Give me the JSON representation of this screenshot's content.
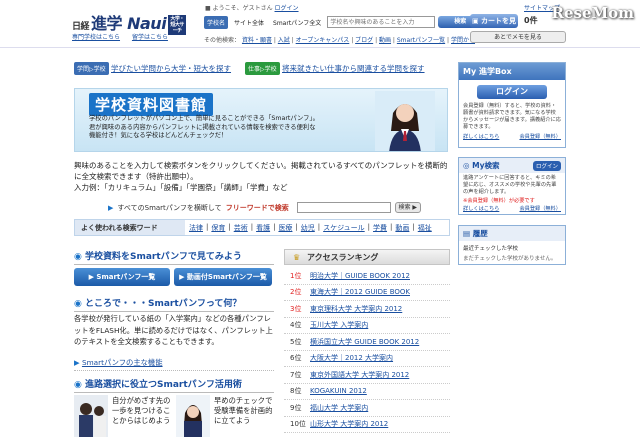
{
  "header": {
    "logo_small": "日経",
    "logo_main": "進学",
    "logo_brand": "Naui",
    "logo_badge": "大学・短大サーチ",
    "welcome": "ようこそ、ゲストさん",
    "login_link": "ログイン",
    "first_time": "専門学校はこちら",
    "abroad": "留学はこちら",
    "search_tabs": [
      "学校名",
      "サイト全体",
      "Smartパンフ全文"
    ],
    "search_placeholder": "学校名や興味のあることを入力",
    "search_button": "検索",
    "other_label": "その他検索：",
    "other_links": [
      "資料・願書",
      "入試",
      "オープンキャンパス",
      "ブログ",
      "動画",
      "Smartパンフ一覧",
      "学問から"
    ],
    "sitemap": "サイトマップ",
    "help": "ヘルプ",
    "cart_button": "カートを見る",
    "cart_count": "0",
    "cart_unit": "件",
    "memo_button": "あとでメモを見る",
    "watermark": "ReseMom"
  },
  "top_links": [
    {
      "tag": "学問▷学校",
      "text": "学びたい学問から大学・短大を探す"
    },
    {
      "tag": "仕事▷学校",
      "text": "将来就きたい仕事から関連する学問を探す"
    }
  ],
  "banner": {
    "title": "学校資料図書館",
    "text": "学校のパンフレットがパソコン上で、簡単に見ることができる「Smartパンフ」。君が興味のある内容からパンフレットに掲載されている情報を検索できる便利な機能付き！気になる学校はどんどんチェックだ！"
  },
  "intro": "興味のあることを入力して検索ボタンをクリックしてください。掲載されているすべてのパンフレットを横断的に全文検索できます（特許出願中）。",
  "example": "入力例：「カリキュラム」「設備」「学園祭」「講師」「学費」など",
  "fulltext": {
    "prefix": "すべてのSmartパンフを横断して",
    "highlight": "フリーワードで検索",
    "button": "検索 ▶"
  },
  "keywords": {
    "label": "よく使われる検索ワード",
    "items": [
      "法律",
      "保育",
      "芸術",
      "看護",
      "医療",
      "幼児",
      "スケジュール",
      "学費",
      "動画",
      "福祉"
    ]
  },
  "see_section": {
    "title": "学校資料をSmartパンフで見てみよう",
    "btn1": "Smartパンフ一覧",
    "btn2": "動画付Smartパンフ一覧"
  },
  "what_section": {
    "title": "ところで・・・Smartパンフって何？",
    "body": "各学校が発行している紙の「入学案内」などの各種パンフレットをFLASH化。単に読めるだけではなく、パンフレット上のテキストを全文検索することもできます。",
    "link": "Smartパンフの主な機能"
  },
  "usage_section": {
    "title": "進路選択に役立つSmartパンフ活用術",
    "left": "自分がめざす先の一歩を見つけることからはじめよう",
    "right": "早めのチェックで受験準備を計画的に立てよう"
  },
  "ranking": {
    "title": "アクセスランキング",
    "items": [
      {
        "rank": "1位",
        "name": "明治大学｜GUIDE BOOK 2012"
      },
      {
        "rank": "2位",
        "name": "東海大学｜2012 GUIDE BOOK"
      },
      {
        "rank": "3位",
        "name": "東京理科大学 大学案内 2012"
      },
      {
        "rank": "4位",
        "name": "玉川大学 入学案内"
      },
      {
        "rank": "5位",
        "name": "横浜国立大学 GUIDE BOOK 2012"
      },
      {
        "rank": "6位",
        "name": "大阪大学｜2012 大学案内"
      },
      {
        "rank": "7位",
        "name": "東京外国語大学 大学案内 2012"
      },
      {
        "rank": "8位",
        "name": "KOGAKUIN 2012"
      },
      {
        "rank": "9位",
        "name": "福山大学 大学案内"
      },
      {
        "rank": "10位",
        "name": "山形大学 大学案内 2012"
      }
    ]
  },
  "sidebar": {
    "box_title": "My 進学Box",
    "login_button": "ログイン",
    "box_text": "会員登録（無料）すると、学校の資料・願書が資料請求できます。気になる学校からメッセージが届きます。講義紹介に応募できます。",
    "box_link1": "詳しくはこちら",
    "box_link2": "会員登録（無料）",
    "my_title": "My検索",
    "my_button": "ログイン",
    "my_text": "進路アンケートに回答すると、キミの希望に応じ、オススメの学校や先輩の先輩の声を紹介します。",
    "my_warn": "※会員登録（無料）が必要です",
    "my_link1": "詳しくはこちら",
    "my_link2": "会員登録（無料）",
    "hist_title": "履歴",
    "hist_sub": "最近チェックした学校",
    "hist_text": "まだチェックした学校がありません。"
  },
  "colors": {
    "accent": "#1a73c8",
    "rank_red": "#e02020",
    "header_bg": "#ffffff"
  }
}
